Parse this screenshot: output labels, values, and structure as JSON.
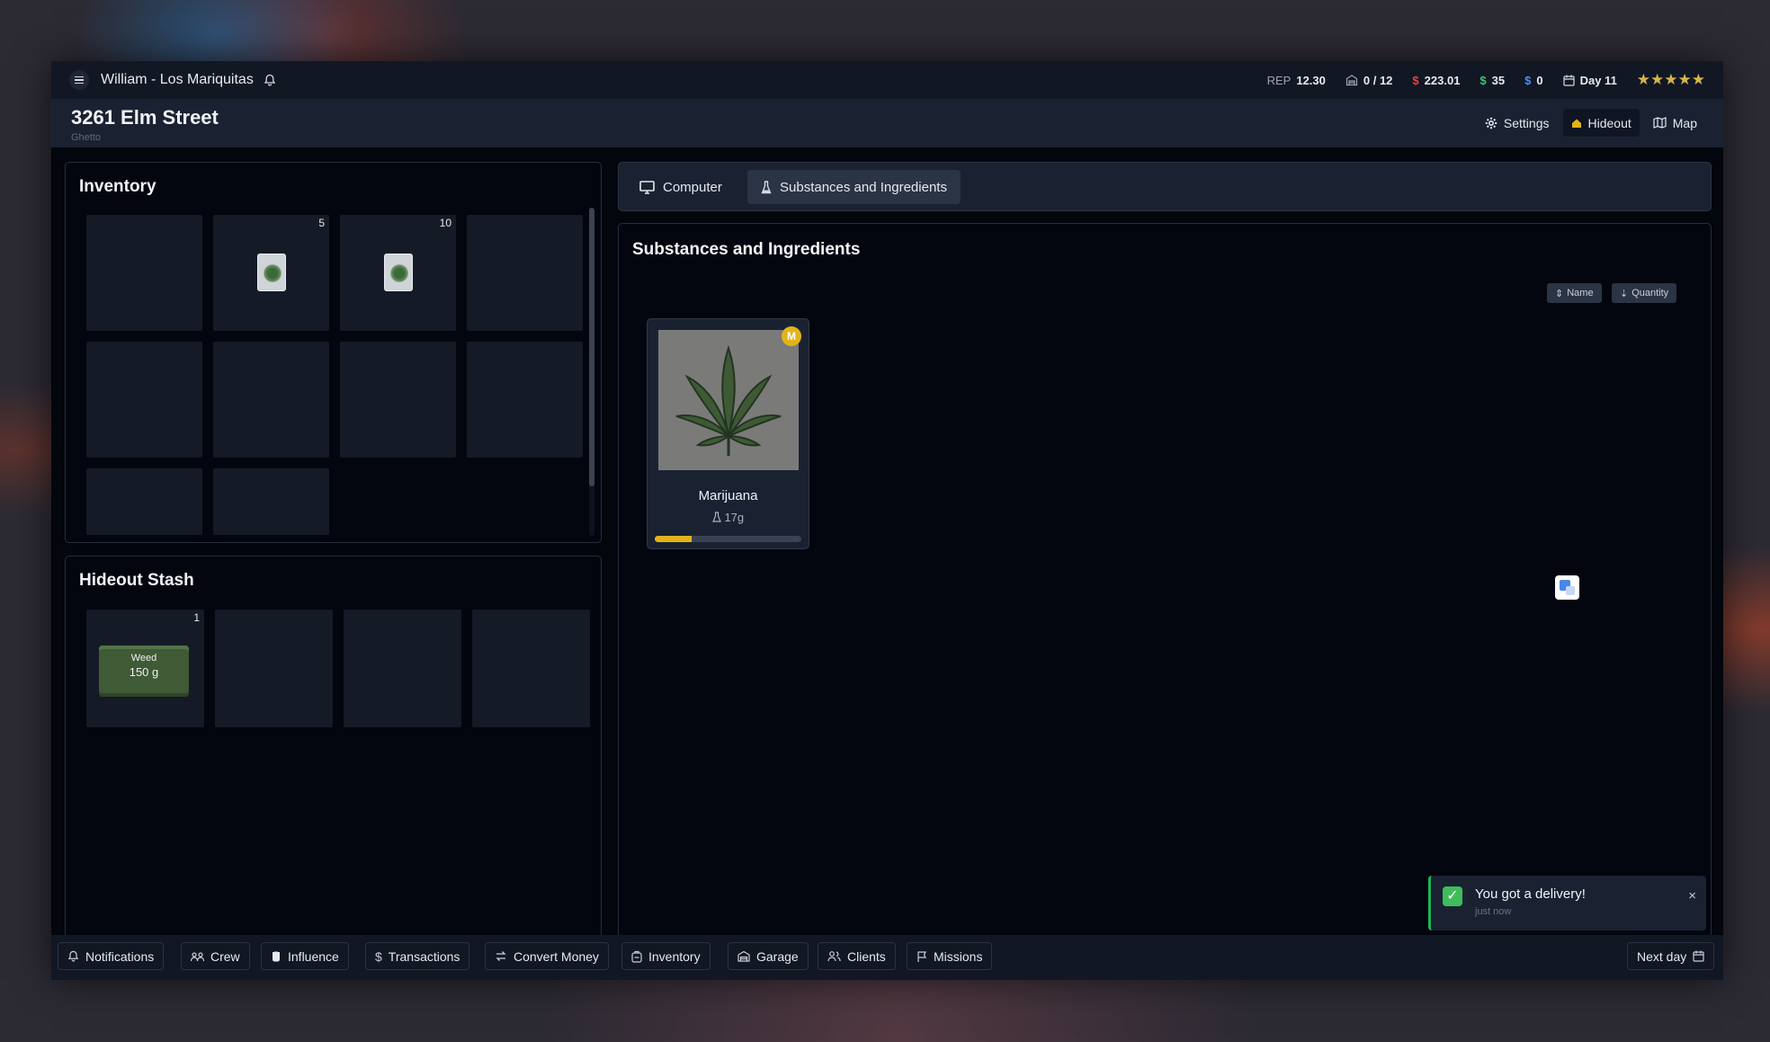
{
  "topbar": {
    "player": "William - Los Mariquitas",
    "rep_label": "REP",
    "rep_value": "12.30",
    "capacity": "0 / 12",
    "cash_dirty": "223.01",
    "cash_green": "35",
    "cash_blue": "0",
    "day": "Day 11",
    "stars": "★★★★★",
    "colors": {
      "red": "#e0453f",
      "green": "#3ec46d",
      "blue": "#4b8ff0",
      "stars": "#d8b54a"
    }
  },
  "header": {
    "address": "3261 Elm Street",
    "district": "Ghetto",
    "nav": {
      "settings": "Settings",
      "hideout": "Hideout",
      "map": "Map"
    }
  },
  "inventory": {
    "title": "Inventory",
    "slots": [
      {
        "count": "",
        "item": ""
      },
      {
        "count": "5",
        "item": "weed-bag-1g"
      },
      {
        "count": "10",
        "item": "weed-bag-1g"
      },
      {
        "count": "",
        "item": ""
      },
      {
        "count": "",
        "item": ""
      },
      {
        "count": "",
        "item": ""
      },
      {
        "count": "",
        "item": ""
      },
      {
        "count": "",
        "item": ""
      },
      {
        "count": "",
        "item": ""
      },
      {
        "count": "",
        "item": ""
      }
    ]
  },
  "stash": {
    "title": "Hideout Stash",
    "slots": [
      {
        "count": "1",
        "name": "Weed",
        "amount": "150 g"
      },
      {
        "count": ""
      },
      {
        "count": ""
      },
      {
        "count": ""
      }
    ]
  },
  "tabs": {
    "computer": "Computer",
    "substances": "Substances and Ingredients"
  },
  "substances": {
    "title": "Substances and Ingredients",
    "sort_name": "Name",
    "sort_quantity": "Quantity",
    "cards": [
      {
        "name": "Marijuana",
        "quantity": "17g",
        "badge": "M",
        "progress": 0.25,
        "icon": "cannabis-leaf-icon"
      }
    ]
  },
  "toast": {
    "title": "You got a delivery!",
    "time": "just now",
    "close": "×",
    "check": "✓"
  },
  "bottombar": {
    "notifications": "Notifications",
    "crew": "Crew",
    "influence": "Influence",
    "transactions": "Transactions",
    "convert_money": "Convert Money",
    "inventory": "Inventory",
    "garage": "Garage",
    "clients": "Clients",
    "missions": "Missions",
    "next_day": "Next day"
  }
}
